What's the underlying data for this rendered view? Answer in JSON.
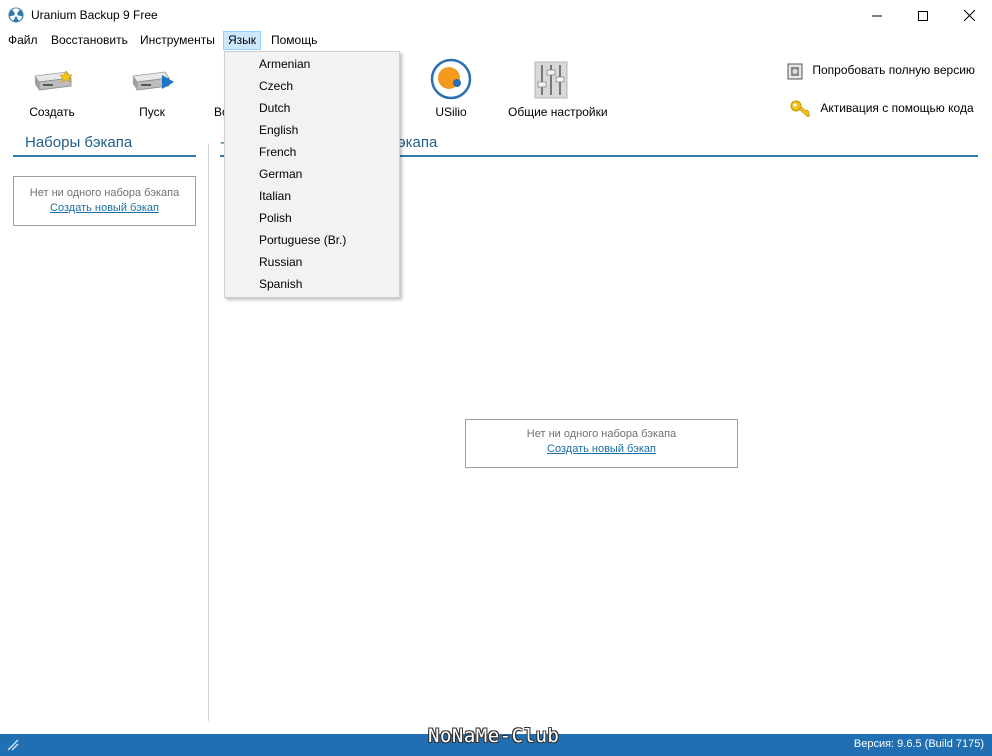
{
  "window": {
    "title": "Uranium Backup 9 Free"
  },
  "menu": {
    "file": "Файл",
    "restore": "Восстановить",
    "tools": "Инструменты",
    "language": "Язык",
    "help": "Помощь"
  },
  "toolbar": {
    "create": "Создать",
    "run": "Пуск",
    "partial": "Во",
    "usilio": "USilio",
    "settings": "Общие настройки"
  },
  "right_links": {
    "try_full": "Попробовать полную версию",
    "activate": "Активация с помощью кода"
  },
  "left_panel": {
    "title": "Наборы бэкапа",
    "empty_text": "Нет ни одного набора бэкапа",
    "create_link": "Создать новый бэкап"
  },
  "main_panel": {
    "title_partial": "экапа",
    "empty_text": "Нет ни одного набора бэкапа",
    "create_link": "Создать новый бэкап"
  },
  "language_menu": {
    "items": [
      "Armenian",
      "Czech",
      "Dutch",
      "English",
      "French",
      "German",
      "Italian",
      "Polish",
      "Portuguese (Br.)",
      "Russian",
      "Spanish"
    ]
  },
  "status": {
    "version": "Версия: 9.6.5 (Build 7175)",
    "watermark": "NoNaMe-Club"
  },
  "colors": {
    "accent": "#1f6fb2",
    "section_title": "#1f5f8b",
    "link": "#1a6ea5",
    "menu_highlight": "#cce8ff"
  }
}
